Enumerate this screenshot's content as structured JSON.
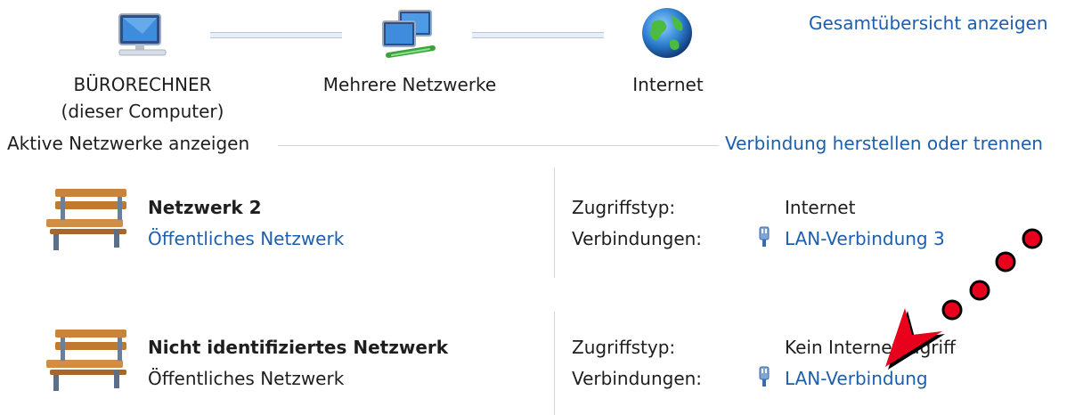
{
  "map": {
    "computer_label_line1": "BÜRORECHNER",
    "computer_label_line2": "(dieser Computer)",
    "network_label": "Mehrere Netzwerke",
    "internet_label": "Internet",
    "full_map_link": "Gesamtübersicht anzeigen"
  },
  "section": {
    "title": "Aktive Netzwerke anzeigen",
    "connect_link": "Verbindung herstellen oder trennen"
  },
  "networks": [
    {
      "name": "Netzwerk  2",
      "type": "Öffentliches Netzwerk",
      "access_label": "Zugriffstyp:",
      "access_value": "Internet",
      "connections_label": "Verbindungen:",
      "connection": "LAN-Verbindung 3"
    },
    {
      "name": "Nicht identifiziertes Netzwerk",
      "type": "Öffentliches Netzwerk",
      "access_label": "Zugriffstyp:",
      "access_value": "Kein Internetzugriff",
      "connections_label": "Verbindungen:",
      "connection": "LAN-Verbindung"
    }
  ],
  "colors": {
    "link": "#1c5fae",
    "annotation": "#e8001c"
  },
  "icons": {
    "computer": "computer-icon",
    "network": "multiple-networks-icon",
    "internet": "globe-icon",
    "bench": "bench-icon",
    "ethernet": "ethernet-plug-icon",
    "annotation": "red-arrow-annotation"
  }
}
